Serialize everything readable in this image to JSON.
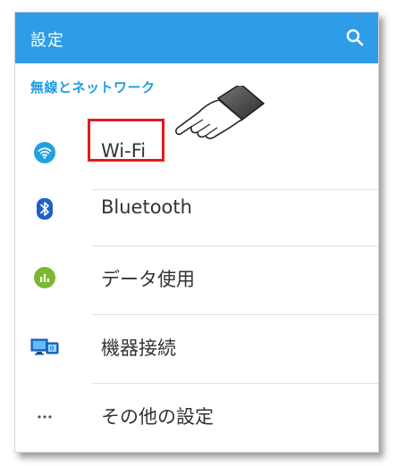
{
  "appbar": {
    "title": "設定",
    "search_icon": "search-icon"
  },
  "section": {
    "header": "無線とネットワーク"
  },
  "items": [
    {
      "label": "Wi-Fi",
      "icon": "wifi-icon"
    },
    {
      "label": "Bluetooth",
      "icon": "bluetooth-icon"
    },
    {
      "label": "データ使用",
      "icon": "data-usage-icon"
    },
    {
      "label": "機器接続",
      "icon": "device-connection-icon"
    },
    {
      "label": "その他の設定",
      "icon": "more-icon"
    }
  ],
  "colors": {
    "appbar": "#2f9ce8",
    "section_header": "#1e9be6",
    "highlight": "#e31a1a",
    "wifi": "#23a0e0",
    "bluetooth": "#1f5fc8",
    "data_usage": "#7cb82f"
  }
}
